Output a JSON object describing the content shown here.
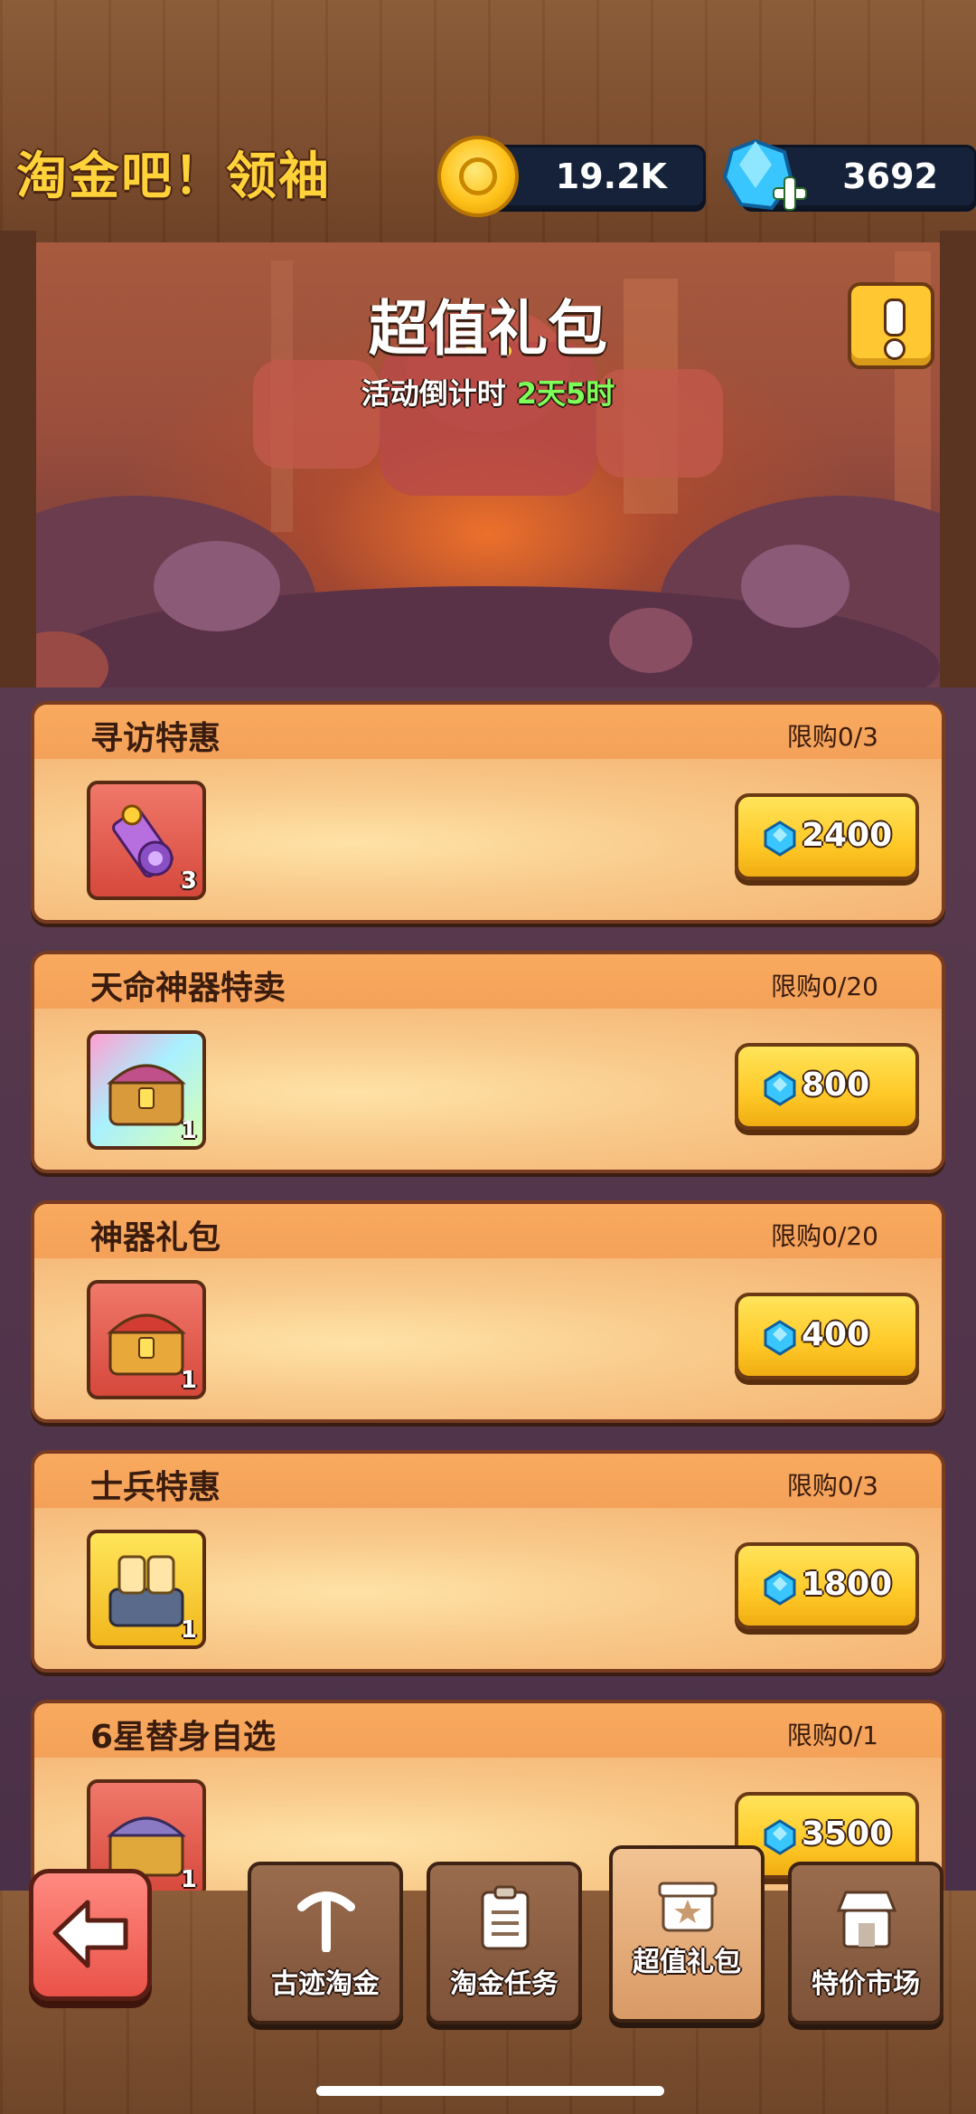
{
  "header": {
    "title": "淘金吧！领袖",
    "coins": "19.2K",
    "gems": "3692"
  },
  "banner": {
    "title": "超值礼包",
    "countdown_label": "活动倒计时",
    "countdown_time": "2天5时"
  },
  "offers": [
    {
      "name": "寻访特惠",
      "limit": "限购0/3",
      "item_count": "3",
      "price": "2400",
      "icon": "scroll-icon"
    },
    {
      "name": "天命神器特卖",
      "limit": "限购0/20",
      "item_count": "1",
      "price": "800",
      "icon": "rainbow-chest-icon"
    },
    {
      "name": "神器礼包",
      "limit": "限购0/20",
      "item_count": "1",
      "price": "400",
      "icon": "gold-chest-icon"
    },
    {
      "name": "士兵特惠",
      "limit": "限购0/3",
      "item_count": "1",
      "price": "1800",
      "icon": "soldier-chest-icon"
    },
    {
      "name": "6星替身自选",
      "limit": "限购0/1",
      "item_count": "1",
      "price": "3500",
      "icon": "purple-chest-icon"
    }
  ],
  "nav": {
    "tabs": [
      {
        "label": "古迹淘金",
        "icon": "pickaxe-icon"
      },
      {
        "label": "淘金任务",
        "icon": "clipboard-icon"
      },
      {
        "label": "超值礼包",
        "icon": "gift-icon",
        "active": true
      },
      {
        "label": "特价市场",
        "icon": "shop-icon"
      }
    ]
  },
  "colors": {
    "accent_gold": "#ffc928",
    "countdown_green": "#7dff5a",
    "card_orange": "#f7b876"
  }
}
